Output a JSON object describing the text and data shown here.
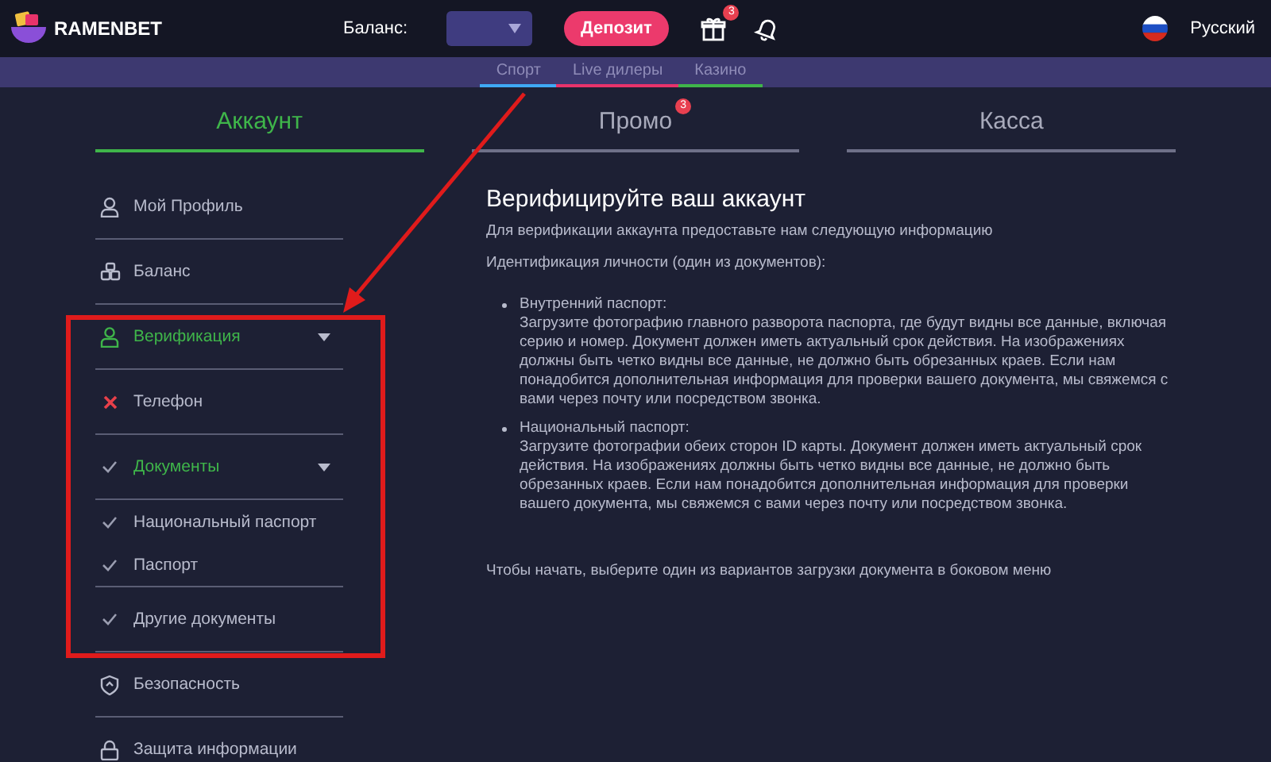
{
  "header": {
    "brand": "RAMENBET",
    "balance_label": "Баланс:",
    "deposit_button": "Депозит",
    "gift_badge": "3",
    "language": "Русский"
  },
  "subnav": [
    {
      "label": "Спорт",
      "color": "#3fa9f5"
    },
    {
      "label": "Live дилеры",
      "color": "#e8336b"
    },
    {
      "label": "Казино",
      "color": "#3fb54a"
    }
  ],
  "tabs": [
    {
      "label": "Аккаунт",
      "selected": true
    },
    {
      "label": "Промо",
      "selected": false,
      "badge": "3"
    },
    {
      "label": "Касса",
      "selected": false
    }
  ],
  "sidebar": {
    "items": [
      {
        "label": "Мой Профиль",
        "kind": "profile",
        "active": false
      },
      {
        "label": "Баланс",
        "kind": "balance",
        "active": false
      },
      {
        "label": "Верификация",
        "kind": "verify",
        "active": true,
        "expanded": true,
        "children": [
          {
            "label": "Телефон",
            "kind": "failed",
            "active": false
          },
          {
            "label": "Документы",
            "kind": "done",
            "active": true,
            "expanded": true,
            "children": [
              {
                "label": "Национальный паспорт",
                "kind": "done",
                "active": false
              },
              {
                "label": "Паспорт",
                "kind": "done",
                "active": false
              }
            ]
          },
          {
            "label": "Другие документы",
            "kind": "done",
            "active": false
          }
        ]
      },
      {
        "label": "Безопасность",
        "kind": "security",
        "active": false
      },
      {
        "label": "Защита информации",
        "kind": "lock",
        "active": false
      }
    ]
  },
  "content": {
    "title": "Верифицируйте ваш аккаунт",
    "intro": "Для верификации аккаунта предоставьте нам следующую информацию",
    "subtitle": "Идентификация личности (один из документов):",
    "documents": [
      {
        "name": "Внутренний паспорт:",
        "text": "Загрузите фотографию главного разворота паспорта, где будут видны все данные, включая серию и номер. Документ должен иметь актуальный срок действия. На изображениях должны быть четко видны все данные, не должно быть обрезанных краев. Если нам понадобится дополнительная информация для проверки вашего документа, мы свяжемся с вами через почту или посредством звонка."
      },
      {
        "name": "Национальный паспорт:",
        "text": "Загрузите фотографии обеих сторон ID карты. Документ должен иметь актуальный срок действия. На изображениях должны быть четко видны все данные, не должно быть обрезанных краев. Если нам понадобится дополнительная информация для проверки вашего документа, мы свяжемся с вами через почту или посредством звонка."
      }
    ],
    "footer": "Чтобы начать, выберите один из вариантов загрузки документа в боковом меню"
  }
}
